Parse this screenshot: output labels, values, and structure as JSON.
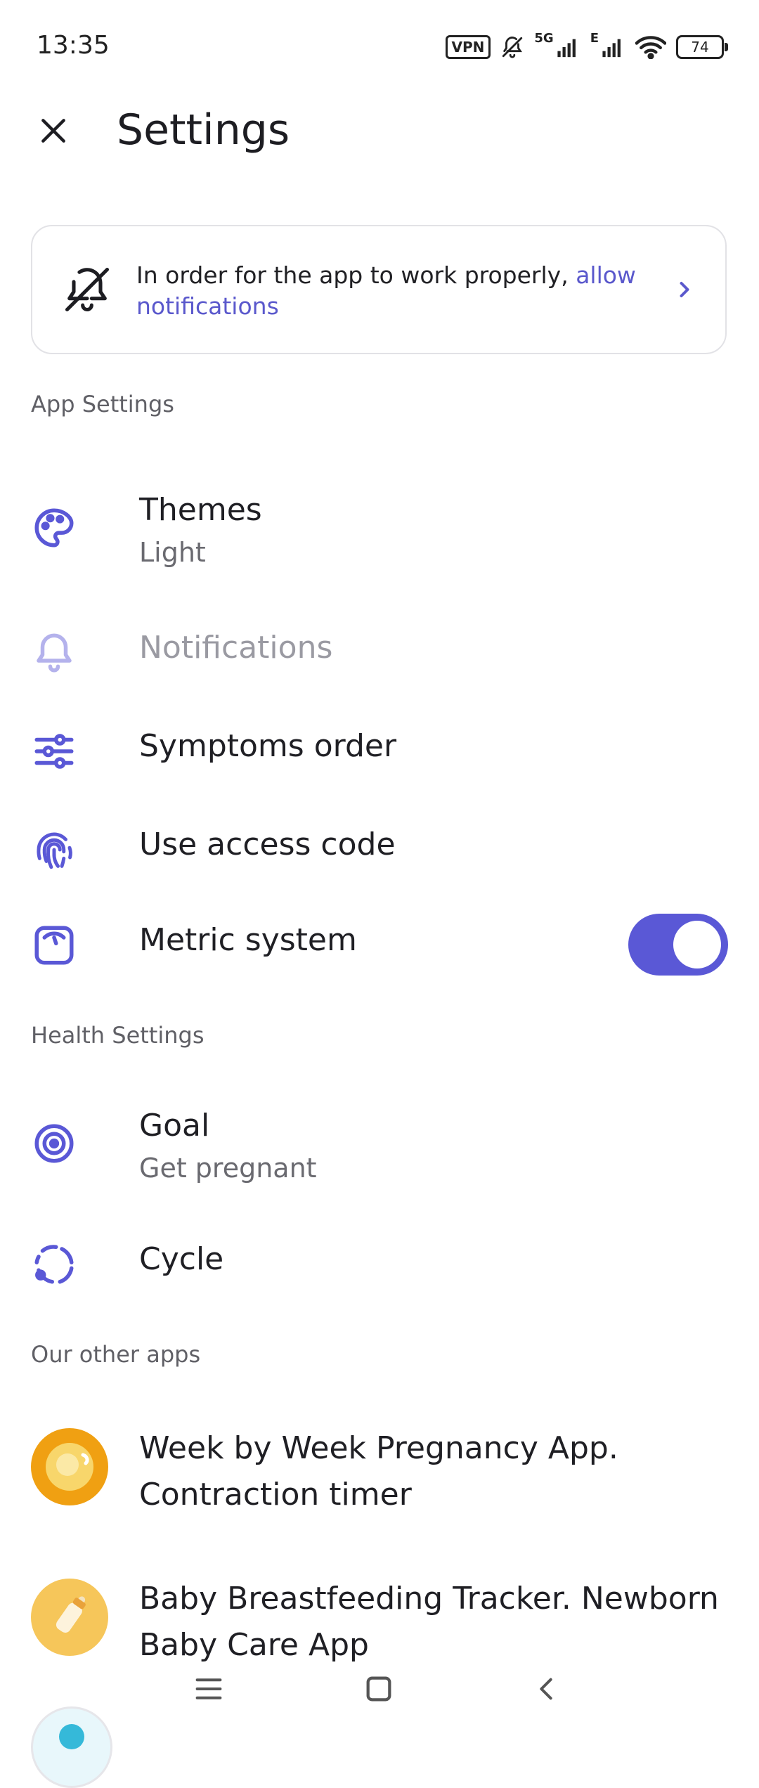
{
  "status_bar": {
    "time": "13:35",
    "vpn": "VPN",
    "network_5g": "5G",
    "network_e": "E",
    "battery": "74",
    "icons": [
      "vpn-icon",
      "bell-off-icon",
      "signal-icon",
      "signal-icon",
      "wifi-icon",
      "battery-icon"
    ]
  },
  "header": {
    "title": "Settings",
    "close_icon": "close-icon"
  },
  "banner": {
    "text": "In order for the app to work properly, ",
    "link": "allow notifications",
    "icon": "bell-off-icon",
    "chevron": "chevron-right-icon"
  },
  "sections": {
    "app_settings": "App Settings",
    "health_settings": "Health Settings",
    "other_apps": "Our other apps"
  },
  "app_settings": {
    "themes": {
      "title": "Themes",
      "value": "Light",
      "icon": "palette-icon"
    },
    "notifications": {
      "title": "Notifications",
      "icon": "bell-icon",
      "disabled": true
    },
    "symptoms_order": {
      "title": "Symptoms order",
      "icon": "sliders-icon"
    },
    "access_code": {
      "title": "Use access code",
      "icon": "fingerprint-icon"
    },
    "metric_system": {
      "title": "Metric system",
      "icon": "scale-icon",
      "enabled": true
    }
  },
  "health_settings": {
    "goal": {
      "title": "Goal",
      "value": "Get pregnant",
      "icon": "target-icon"
    },
    "cycle": {
      "title": "Cycle",
      "icon": "cycle-icon"
    }
  },
  "other_apps": [
    {
      "title": "Week by Week Pregnancy App. Contraction timer",
      "icon": "pregnancy-app-icon"
    },
    {
      "title": "Baby Breastfeeding Tracker. Newborn Baby Care App",
      "icon": "baby-bottle-app-icon"
    }
  ],
  "nav_bar": {
    "icons": [
      "menu-icon",
      "home-square-icon",
      "back-icon"
    ]
  },
  "colors": {
    "accent": "#5a58d6",
    "link": "#5a58cc",
    "muted": "#9a9aa2"
  }
}
